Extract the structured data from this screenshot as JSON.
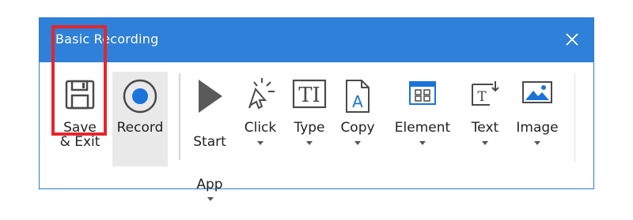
{
  "window": {
    "title": "Basic Recording"
  },
  "toolbar": {
    "save_exit_label": "Save\n& Exit",
    "record_label": "Record",
    "start_app_label_1": "Start",
    "start_app_label_2": "App",
    "click_label": "Click",
    "type_label": "Type",
    "copy_label": "Copy",
    "element_label": "Element",
    "text_label": "Text",
    "image_label": "Image"
  },
  "colors": {
    "titlebar": "#2f80d8",
    "highlight": "#e5262b",
    "icon_blue": "#1a73d9",
    "icon_gray": "#555555"
  }
}
